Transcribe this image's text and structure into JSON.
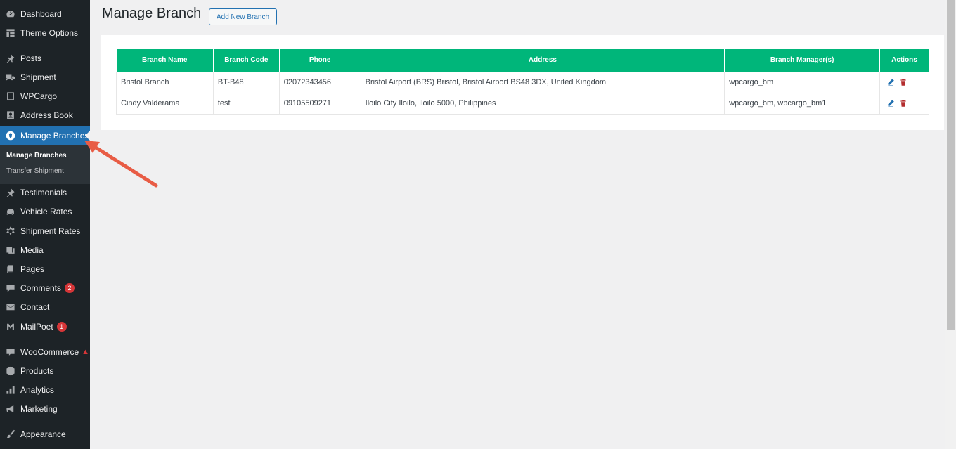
{
  "sidebar": {
    "items": [
      {
        "label": "Dashboard",
        "icon": "dashboard-icon"
      },
      {
        "label": "Theme Options",
        "icon": "grid-icon"
      },
      {
        "label": "Posts",
        "icon": "pin-icon"
      },
      {
        "label": "Shipment",
        "icon": "truck-icon"
      },
      {
        "label": "WPCargo",
        "icon": "document-icon"
      },
      {
        "label": "Address Book",
        "icon": "addressbook-icon"
      },
      {
        "label": "Manage Branches",
        "icon": "location-icon"
      },
      {
        "label": "Testimonials",
        "icon": "pin-icon"
      },
      {
        "label": "Vehicle Rates",
        "icon": "car-icon"
      },
      {
        "label": "Shipment Rates",
        "icon": "gear-icon"
      },
      {
        "label": "Media",
        "icon": "media-icon"
      },
      {
        "label": "Pages",
        "icon": "pages-icon"
      },
      {
        "label": "Comments",
        "icon": "comment-icon",
        "badge": "2"
      },
      {
        "label": "Contact",
        "icon": "mail-icon"
      },
      {
        "label": "MailPoet",
        "icon": "mailpoet-icon",
        "badge": "1"
      },
      {
        "label": "WooCommerce",
        "icon": "woo-icon",
        "warning": "▲"
      },
      {
        "label": "Products",
        "icon": "box-icon"
      },
      {
        "label": "Analytics",
        "icon": "bar-chart-icon"
      },
      {
        "label": "Marketing",
        "icon": "megaphone-icon"
      },
      {
        "label": "Appearance",
        "icon": "brush-icon"
      }
    ],
    "submenu": [
      {
        "label": "Manage Branches"
      },
      {
        "label": "Transfer Shipment"
      }
    ]
  },
  "main": {
    "title": "Manage Branch",
    "add_button": "Add New Branch",
    "table": {
      "headers": [
        "Branch Name",
        "Branch Code",
        "Phone",
        "Address",
        "Branch Manager(s)",
        "Actions"
      ],
      "rows": [
        {
          "name": "Bristol Branch",
          "code": "BT-B48",
          "phone": "02072343456",
          "address": "Bristol Airport (BRS) Bristol, Bristol Airport BS48 3DX, United Kingdom",
          "managers": "wpcargo_bm"
        },
        {
          "name": "Cindy Valderama",
          "code": "test",
          "phone": "09105509271",
          "address": "Iloilo City Iloilo, Iloilo 5000, Philippines",
          "managers": "wpcargo_bm, wpcargo_bm1"
        }
      ]
    }
  },
  "colors": {
    "sidebar_bg": "#1d2327",
    "active_bg": "#2271b1",
    "table_header": "#00b67a",
    "delete": "#b32d2e",
    "edit": "#2271b1",
    "annotation": "#e85c45"
  }
}
